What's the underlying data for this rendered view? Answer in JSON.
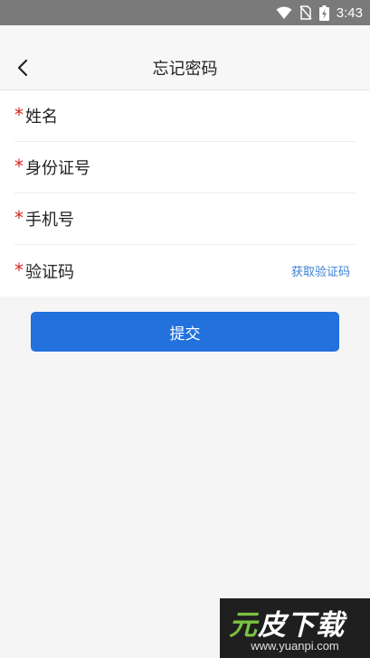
{
  "status_bar": {
    "time": "3:43",
    "icons": [
      "wifi-icon",
      "no-sim-icon",
      "battery-charging-icon"
    ]
  },
  "header": {
    "title": "忘记密码",
    "back_icon": "chevron-left-icon"
  },
  "form": {
    "required_mark": "*",
    "fields": [
      {
        "label": "姓名",
        "value": "",
        "placeholder": ""
      },
      {
        "label": "身份证号",
        "value": "",
        "placeholder": ""
      },
      {
        "label": "手机号",
        "value": "",
        "placeholder": ""
      },
      {
        "label": "验证码",
        "value": "",
        "placeholder": ""
      }
    ],
    "get_code_label": "获取验证码"
  },
  "submit_label": "提交",
  "colors": {
    "accent": "#2271dc",
    "link": "#3a82d6",
    "required": "#d9231c"
  },
  "watermark": {
    "logo_part1": "元",
    "logo_part2": "皮下载",
    "url": "www.yuanpi.com"
  }
}
